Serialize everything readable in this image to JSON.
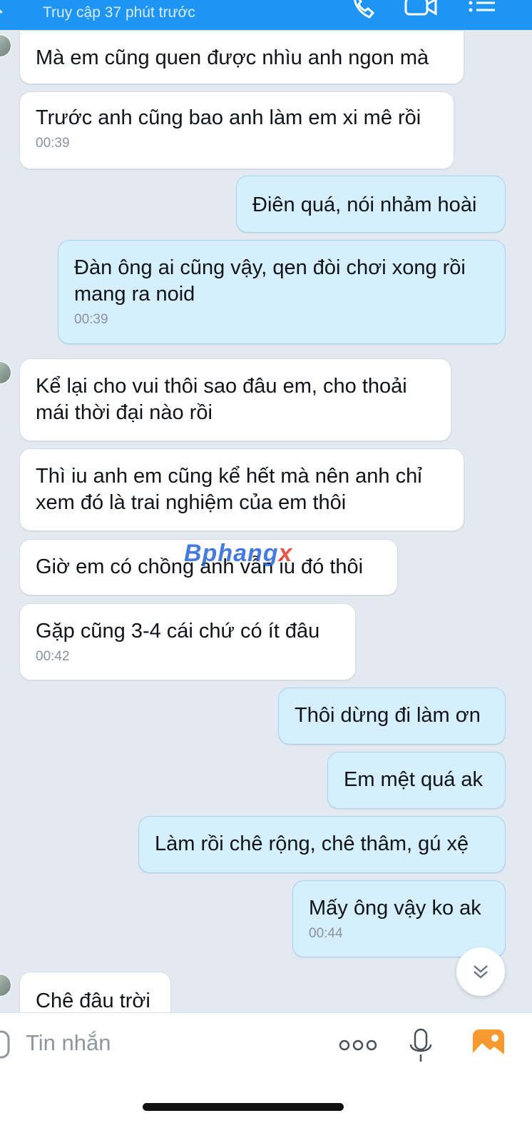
{
  "header": {
    "status": "Truy cập 37 phút trước"
  },
  "messages": [
    {
      "text": "Mà em cũng quen được nhìu anh ngon mà",
      "time": ""
    },
    {
      "text": "Trước anh cũng bao anh làm em xi mê rồi",
      "time": "00:39"
    },
    {
      "text": "Điên quá, nói nhảm hoài",
      "time": ""
    },
    {
      "text": "Đàn ông ai cũng vậy, qen đòi chơi xong rồi mang ra noid",
      "time": "00:39"
    },
    {
      "text": "Kể lại cho vui thôi sao đâu em, cho thoải mái thời đại nào rồi",
      "time": ""
    },
    {
      "text": "Thì iu anh em cũng kể hết mà nên anh chỉ xem đó là trai nghiệm của em thôi",
      "time": ""
    },
    {
      "text": "Giờ em có chồng anh vẫn iu đó thôi",
      "time": ""
    },
    {
      "text": "Gặp cũng 3-4 cái chứ có ít đâu",
      "time": "00:42"
    },
    {
      "text": "Thôi dừng đi làm ơn",
      "time": ""
    },
    {
      "text": "Em mệt quá ak",
      "time": ""
    },
    {
      "text": "Làm rồi chê rộng, chê thâm, gú xệ",
      "time": ""
    },
    {
      "text": "Mấy ông vậy ko ak",
      "time": "00:44"
    },
    {
      "text": "Chê đâu trời",
      "time": ""
    }
  ],
  "watermark": {
    "main": "Bphang",
    "accent": "x"
  },
  "input": {
    "placeholder": "Tin nhắn"
  },
  "icons": [
    "back-icon",
    "phone-icon",
    "video-icon",
    "menu-icon",
    "chevron-double-down-icon",
    "sticker-icon",
    "more-icon",
    "microphone-icon",
    "image-icon"
  ],
  "colors": {
    "header": "#1e95f5",
    "sent_bubble": "#d5efff",
    "received_bubble": "#ffffff",
    "background": "#e2e9f1"
  }
}
